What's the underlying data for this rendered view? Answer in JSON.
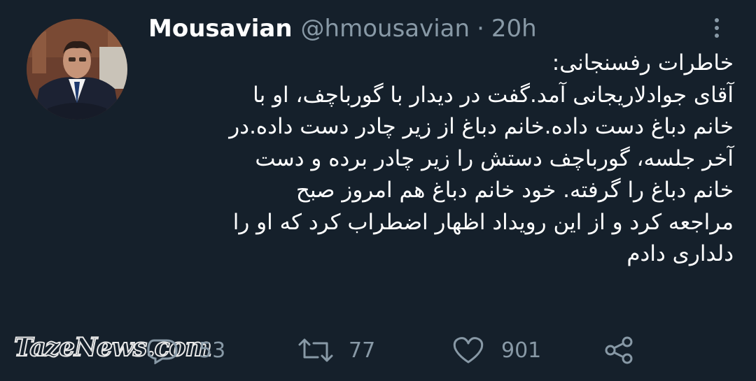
{
  "tweet": {
    "display_name": "Mousavian",
    "handle": "@hmousavian",
    "separator": "·",
    "time": "20h",
    "body_lines": [
      "خاطرات رفسنجانی:",
      "آقای جوادلاریجانی آمد.گفت در دیدار با گورباچف، او با",
      "خانم دباغ دست داده.خانم دباغ از زیر چادر دست داده.در",
      "آخر جلسه، گورباچف دستش را زیر چادر برده و دست",
      "خانم دباغ را گرفته. خود خانم دباغ هم امروز صبح",
      "مراجعه کرد و از این رویداد اظهار اضطراب کرد که او را",
      "دلداری دادم"
    ]
  },
  "actions": {
    "reply_count": "53",
    "retweet_count": "77",
    "like_count": "901"
  },
  "watermark": "TazeNews.com",
  "icons": {
    "reply": "reply-icon",
    "retweet": "retweet-icon",
    "like": "heart-icon",
    "share": "share-icon",
    "more": "more-vertical-icon"
  },
  "colors": {
    "background": "#15202b",
    "text": "#ffffff",
    "secondary": "#8899a6"
  }
}
